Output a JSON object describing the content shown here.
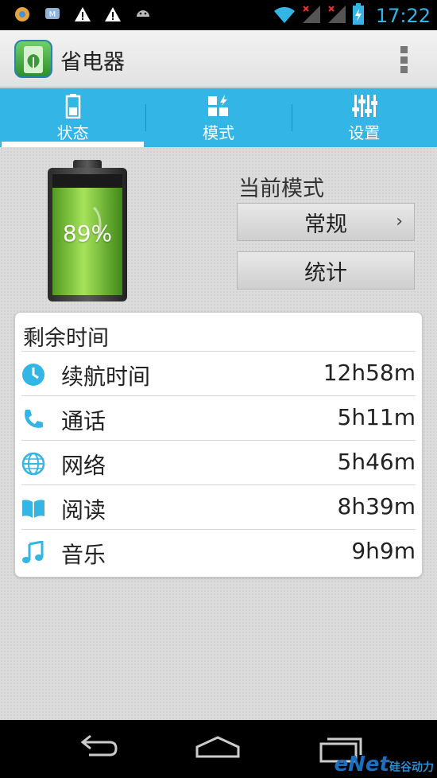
{
  "status_bar": {
    "time": "17:22",
    "icons": [
      "photos-icon",
      "messenger-icon",
      "warning-icon",
      "warning-icon",
      "android-icon",
      "wifi-icon",
      "signal-icon",
      "signal-icon",
      "battery-charging-icon"
    ]
  },
  "app": {
    "title": "省电器"
  },
  "tabs": [
    {
      "label": "状态",
      "icon": "battery-icon",
      "active": true
    },
    {
      "label": "模式",
      "icon": "mode-icon",
      "active": false
    },
    {
      "label": "设置",
      "icon": "sliders-icon",
      "active": false
    }
  ],
  "battery": {
    "percent_text": "89%",
    "level": 0.89
  },
  "mode": {
    "title": "当前模式",
    "current_label": "常规",
    "chevron": "›",
    "stats_label": "统计"
  },
  "remaining": {
    "title": "剩余时间",
    "rows": [
      {
        "label": "续航时间",
        "value": "12h58m",
        "icon": "clock-icon"
      },
      {
        "label": "通话",
        "value": "5h11m",
        "icon": "phone-icon"
      },
      {
        "label": "网络",
        "value": "5h46m",
        "icon": "globe-icon"
      },
      {
        "label": "阅读",
        "value": "8h39m",
        "icon": "book-icon"
      },
      {
        "label": "音乐",
        "value": "9h9m",
        "icon": "music-icon"
      }
    ]
  },
  "watermark": {
    "brand": "eNet",
    "sub": "硅谷动力"
  },
  "colors": {
    "accent": "#33b5e5",
    "battery_green": "#7ac943"
  }
}
